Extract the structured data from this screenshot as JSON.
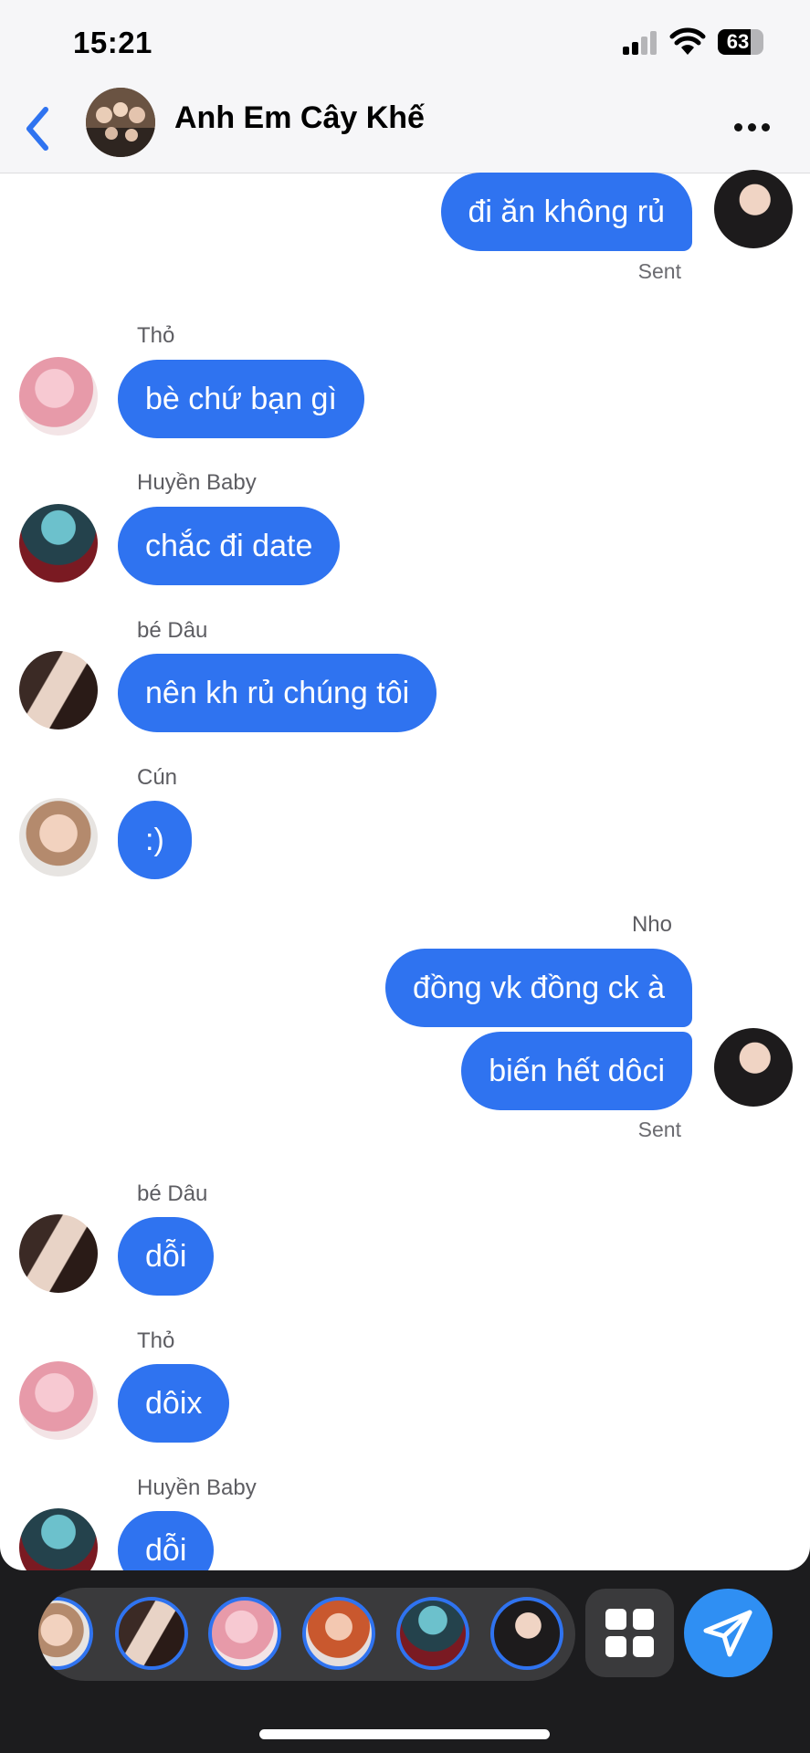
{
  "status_bar": {
    "time": "15:21",
    "battery": "63"
  },
  "header": {
    "title": "Anh Em Cây Khế"
  },
  "messages": [
    {
      "side": "right",
      "text": "đi ăn không rủ",
      "status": "Sent"
    },
    {
      "side": "left",
      "sender": "Thỏ",
      "text": "bè chứ bạn gì"
    },
    {
      "side": "left",
      "sender": "Huyền Baby",
      "text": "chắc đi date"
    },
    {
      "side": "left",
      "sender": "bé Dâu",
      "text": "nên kh rủ chúng tôi"
    },
    {
      "side": "left",
      "sender": "Cún",
      "text": ":)"
    },
    {
      "side": "right",
      "sender": "Nho",
      "text": "đồng vk đồng ck à"
    },
    {
      "side": "right",
      "text": "biến hết dôci",
      "status": "Sent"
    },
    {
      "side": "left",
      "sender": "bé Dâu",
      "text": "dỗi"
    },
    {
      "side": "left",
      "sender": "Thỏ",
      "text": "dôix"
    },
    {
      "side": "left",
      "sender": "Huyền Baby",
      "text": "dỗi"
    }
  ],
  "colors": {
    "bubble": "#2f73f0",
    "send": "#2f8ff3",
    "header_bg": "#f6f6f8",
    "tray": "#1c1c1e"
  },
  "icons": [
    "back-icon",
    "more-icon",
    "apps-grid-icon",
    "send-icon",
    "wifi-icon",
    "signal-icon",
    "battery-icon"
  ]
}
